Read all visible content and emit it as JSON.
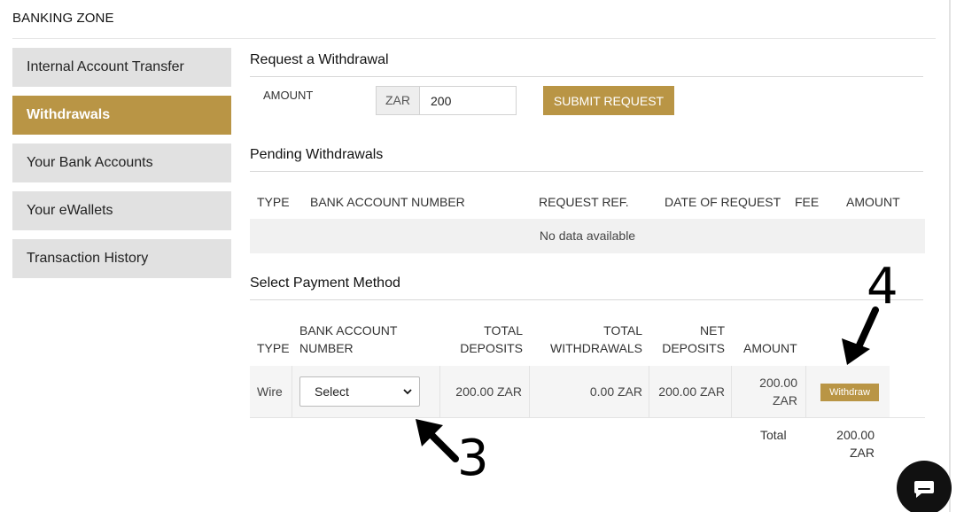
{
  "page": {
    "title": "BANKING ZONE"
  },
  "sidebar": {
    "items": [
      {
        "label": "Internal Account Transfer",
        "active": false
      },
      {
        "label": "Withdrawals",
        "active": true
      },
      {
        "label": "Your Bank Accounts",
        "active": false
      },
      {
        "label": "Your eWallets",
        "active": false
      },
      {
        "label": "Transaction History",
        "active": false
      }
    ]
  },
  "request": {
    "heading": "Request a Withdrawal",
    "amount_label": "AMOUNT",
    "currency": "ZAR",
    "amount_value": "200",
    "submit_label": "SUBMIT REQUEST"
  },
  "pending": {
    "heading": "Pending Withdrawals",
    "columns": [
      "TYPE",
      "BANK ACCOUNT NUMBER",
      "REQUEST REF.",
      "DATE OF REQUEST",
      "FEE",
      "AMOUNT"
    ],
    "empty_text": "No data available"
  },
  "payment": {
    "heading": "Select Payment Method",
    "columns": {
      "type": "TYPE",
      "bank_1": "BANK ACCOUNT",
      "bank_2": "NUMBER",
      "dep_1": "TOTAL",
      "dep_2": "DEPOSITS",
      "wd_1": "TOTAL",
      "wd_2": "WITHDRAWALS",
      "net_1": "NET",
      "net_2": "DEPOSITS",
      "amount": "AMOUNT"
    },
    "row": {
      "type": "Wire",
      "select_value": "Select",
      "total_deposits": "200.00 ZAR",
      "total_withdrawals": "0.00 ZAR",
      "net_deposits": "200.00 ZAR",
      "amount_1": "200.00",
      "amount_2": "ZAR",
      "withdraw_label": "Withdraw"
    },
    "total_label": "Total",
    "total_1": "200.00",
    "total_2": "ZAR"
  },
  "annotations": {
    "step_3": "3",
    "step_4": "4"
  },
  "colors": {
    "accent": "#b99545",
    "sidebar_bg": "#e1e1e1",
    "row_bg": "#f5f5f5"
  },
  "icons": {
    "chat": "chat-bubble-icon",
    "dropdown": "chevron-down-icon",
    "arrow": "arrow-icon"
  }
}
